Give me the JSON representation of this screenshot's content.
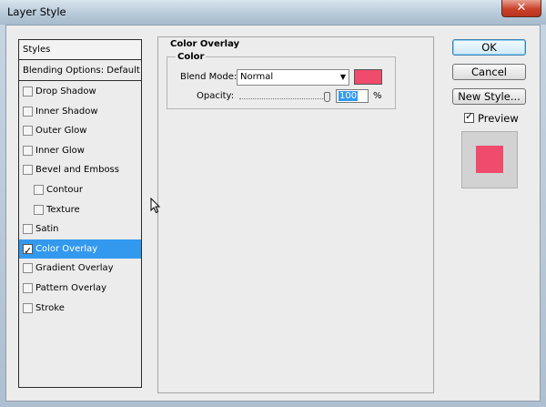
{
  "window": {
    "title": "Layer Style",
    "close_glyph": "✕"
  },
  "styles_panel": {
    "header": "Styles",
    "blending_options": "Blending Options: Default",
    "items": [
      {
        "label": "Drop Shadow",
        "checked": false,
        "indent": false
      },
      {
        "label": "Inner Shadow",
        "checked": false,
        "indent": false
      },
      {
        "label": "Outer Glow",
        "checked": false,
        "indent": false
      },
      {
        "label": "Inner Glow",
        "checked": false,
        "indent": false
      },
      {
        "label": "Bevel and Emboss",
        "checked": false,
        "indent": false
      },
      {
        "label": "Contour",
        "checked": false,
        "indent": true
      },
      {
        "label": "Texture",
        "checked": false,
        "indent": true
      },
      {
        "label": "Satin",
        "checked": false,
        "indent": false
      },
      {
        "label": "Color Overlay",
        "checked": true,
        "indent": false,
        "selected": true
      },
      {
        "label": "Gradient Overlay",
        "checked": false,
        "indent": false
      },
      {
        "label": "Pattern Overlay",
        "checked": false,
        "indent": false
      },
      {
        "label": "Stroke",
        "checked": false,
        "indent": false
      }
    ]
  },
  "color_overlay": {
    "section_title": "Color Overlay",
    "group_title": "Color",
    "blend_mode_label": "Blend Mode:",
    "blend_mode_value": "Normal",
    "overlay_color": "#f04a6c",
    "opacity_label": "Opacity:",
    "opacity_value": "100",
    "opacity_unit": "%",
    "opacity_fraction": 1.0
  },
  "buttons": {
    "ok": "OK",
    "cancel": "Cancel",
    "new_style": "New Style...",
    "preview_label": "Preview",
    "preview_checked": true
  },
  "check_glyph": "✓",
  "dropdown_glyph": "▼"
}
